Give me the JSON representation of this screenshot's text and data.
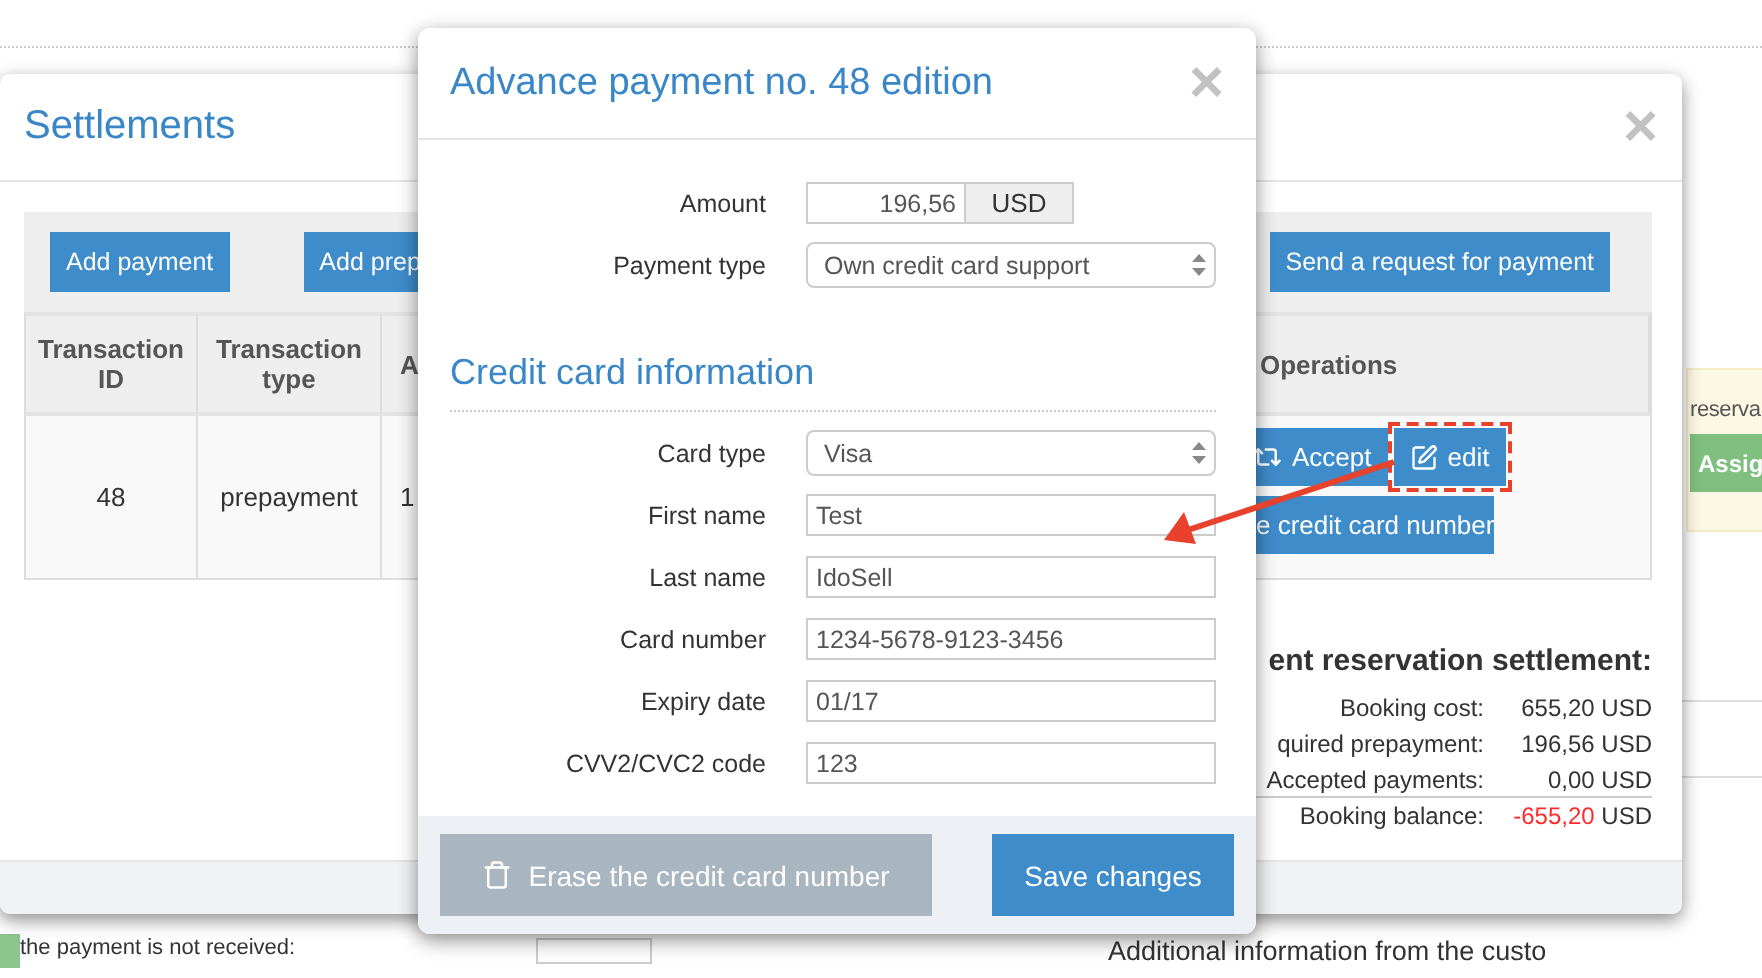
{
  "page": {
    "notice": "reserva",
    "assign_button": "Assig",
    "payment_note": "the payment is not received:",
    "additional_info": "Additional information from the custo"
  },
  "settlements": {
    "title": "Settlements",
    "close": "×",
    "toolbar": {
      "left": [
        "Add payment",
        "Add prep"
      ],
      "right": [
        "Send a request for payment"
      ]
    },
    "table": {
      "columns": [
        "Transaction ID",
        "Transaction type",
        "A",
        "Operations"
      ],
      "rows": [
        {
          "transaction_id": "48",
          "transaction_type": "prepayment",
          "column_3": "1",
          "operations": [
            {
              "kind": "accept",
              "label": "Accept",
              "highlighted": false
            },
            {
              "kind": "edit",
              "label": "edit",
              "highlighted": true
            },
            {
              "kind": "erase",
              "label": "e credit card number",
              "highlighted": false
            }
          ]
        }
      ]
    },
    "summary": {
      "title": "ent reservation settlement:",
      "lines": [
        {
          "label": "Booking cost:",
          "amount": "655,20",
          "currency": "USD",
          "negative": false
        },
        {
          "label": "quired prepayment:",
          "amount": "196,56",
          "currency": "USD",
          "negative": false
        },
        {
          "label": "Accepted payments:",
          "amount": "0,00",
          "currency": "USD",
          "negative": false
        },
        {
          "label": "Booking balance:",
          "amount": "-655,20",
          "currency": "USD",
          "negative": true
        }
      ]
    }
  },
  "dialog": {
    "title": "Advance payment no. 48 edition",
    "close": "×",
    "payment_fields": [
      {
        "kind": "amount",
        "label": "Amount",
        "value": "196,56",
        "unit": "USD"
      },
      {
        "kind": "select",
        "label": "Payment type",
        "value": "Own credit card support"
      }
    ],
    "card_section": "Credit card information",
    "card_fields": [
      {
        "kind": "select",
        "label": "Card type",
        "value": "Visa"
      },
      {
        "kind": "text",
        "label": "First name",
        "value": "Test"
      },
      {
        "kind": "text",
        "label": "Last name",
        "value": "IdoSell"
      },
      {
        "kind": "text",
        "label": "Card number",
        "value": "1234-5678-9123-3456"
      },
      {
        "kind": "text",
        "label": "Expiry date",
        "value": "01/17"
      },
      {
        "kind": "text",
        "label": "CVV2/CVC2 code",
        "value": "123"
      }
    ],
    "buttons": [
      {
        "kind": "erase",
        "label": "Erase the credit card number"
      },
      {
        "kind": "save",
        "label": "Save changes"
      }
    ]
  }
}
